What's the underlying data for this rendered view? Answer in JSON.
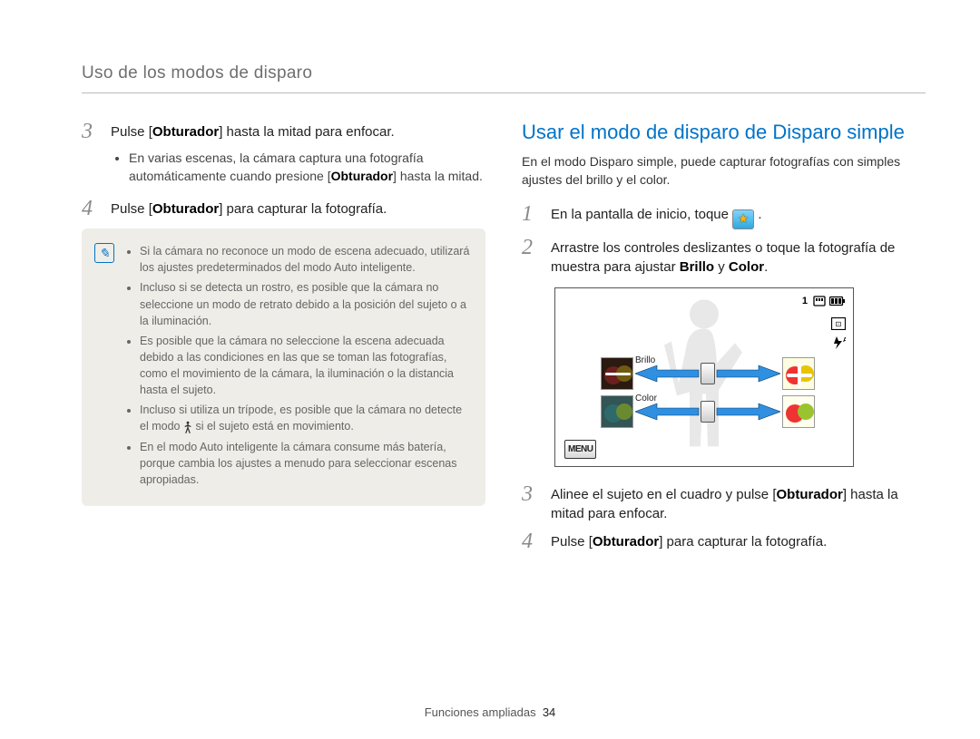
{
  "header": "Uso de los modos de disparo",
  "left": {
    "step3": {
      "num": "3",
      "text_before": "Pulse [",
      "bold1": "Obturador",
      "text_after": "] hasta la mitad para enfocar."
    },
    "step3_sub_before": "En varias escenas, la cámara captura una fotografía automáticamente cuando presione [",
    "step3_sub_bold": "Obturador",
    "step3_sub_after": "] hasta la mitad.",
    "step4": {
      "num": "4",
      "text_before": "Pulse [",
      "bold1": "Obturador",
      "text_after": "] para capturar la fotografía."
    },
    "notes": [
      "Si la cámara no reconoce un modo de escena adecuado, utilizará los ajustes predeterminados del modo Auto inteligente.",
      "Incluso si se detecta un rostro, es posible que la cámara no seleccione un modo de retrato debido a la posición del sujeto o a la iluminación.",
      "Es posible que la cámara no seleccione la escena adecuada debido a las condiciones en las que se toman las fotografías, como el movimiento de la cámara, la iluminación o la distancia hasta el sujeto.",
      {
        "pre": "Incluso si utiliza un trípode, es posible que la cámara no detecte el modo ",
        "post": " si el sujeto está en movimiento."
      },
      "En el modo Auto inteligente la cámara consume más batería, porque cambia los ajustes a menudo para seleccionar escenas apropiadas."
    ]
  },
  "right": {
    "title": "Usar el modo de disparo de Disparo simple",
    "desc": "En el modo Disparo simple, puede capturar fotografías con simples ajustes del brillo y el color.",
    "step1": {
      "num": "1",
      "text": "En la pantalla de inicio, toque ",
      "trailing": "."
    },
    "step2": {
      "num": "2",
      "text_before": "Arrastre los controles deslizantes o toque la fotografía de muestra para ajustar ",
      "b1": "Brillo",
      "mid": " y ",
      "b2": "Color",
      "after": "."
    },
    "preview": {
      "count": "1",
      "menu": "MENU",
      "slider_brightness_label": "Brillo",
      "slider_color_label": "Color"
    },
    "step3": {
      "num": "3",
      "before": "Alinee el sujeto en el cuadro y pulse [",
      "bold": "Obturador",
      "after": "] hasta la mitad para enfocar."
    },
    "step4": {
      "num": "4",
      "before": "Pulse [",
      "bold": "Obturador",
      "after": "] para capturar la fotografía."
    }
  },
  "footer": {
    "label": "Funciones ampliadas",
    "page": "34"
  }
}
